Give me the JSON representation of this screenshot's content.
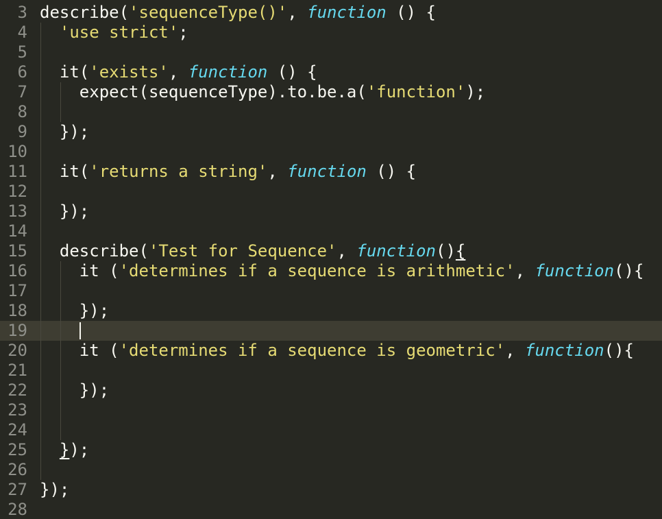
{
  "editor": {
    "colors": {
      "background": "#272822",
      "foreground": "#f8f8f2",
      "string": "#e6db74",
      "keyword_function": "#66d9ef",
      "gutter": "#8f908a",
      "current_line": "#3e3d32",
      "indent_guide": "#49483e"
    },
    "current_line": 19,
    "lines": [
      {
        "n": "3",
        "indent": 0,
        "tokens": [
          {
            "t": "txt",
            "v": "describe("
          },
          {
            "t": "str",
            "v": "'sequenceType()'"
          },
          {
            "t": "txt",
            "v": ", "
          },
          {
            "t": "fn",
            "v": "function"
          },
          {
            "t": "txt",
            "v": " () {"
          }
        ]
      },
      {
        "n": "4",
        "indent": 1,
        "tokens": [
          {
            "t": "str",
            "v": "'use strict'"
          },
          {
            "t": "txt",
            "v": ";"
          }
        ]
      },
      {
        "n": "5",
        "indent": 0,
        "tokens": []
      },
      {
        "n": "6",
        "indent": 1,
        "tokens": [
          {
            "t": "txt",
            "v": "it("
          },
          {
            "t": "str",
            "v": "'exists'"
          },
          {
            "t": "txt",
            "v": ", "
          },
          {
            "t": "fn",
            "v": "function"
          },
          {
            "t": "txt",
            "v": " () {"
          }
        ]
      },
      {
        "n": "7",
        "indent": 2,
        "tokens": [
          {
            "t": "txt",
            "v": "expect(sequenceType).to.be.a("
          },
          {
            "t": "str",
            "v": "'function'"
          },
          {
            "t": "txt",
            "v": ");"
          }
        ]
      },
      {
        "n": "8",
        "indent": 0,
        "tokens": []
      },
      {
        "n": "9",
        "indent": 1,
        "tokens": [
          {
            "t": "txt",
            "v": "});"
          }
        ]
      },
      {
        "n": "10",
        "indent": 0,
        "tokens": []
      },
      {
        "n": "11",
        "indent": 1,
        "tokens": [
          {
            "t": "txt",
            "v": "it("
          },
          {
            "t": "str",
            "v": "'returns a string'"
          },
          {
            "t": "txt",
            "v": ", "
          },
          {
            "t": "fn",
            "v": "function"
          },
          {
            "t": "txt",
            "v": " () {"
          }
        ]
      },
      {
        "n": "12",
        "indent": 0,
        "tokens": []
      },
      {
        "n": "13",
        "indent": 1,
        "tokens": [
          {
            "t": "txt",
            "v": "});"
          }
        ]
      },
      {
        "n": "14",
        "indent": 0,
        "tokens": []
      },
      {
        "n": "15",
        "indent": 1,
        "tokens": [
          {
            "t": "txt",
            "v": "describe("
          },
          {
            "t": "str",
            "v": "'Test for Sequence'"
          },
          {
            "t": "txt",
            "v": ", "
          },
          {
            "t": "fn",
            "v": "function"
          },
          {
            "t": "txt",
            "v": "()"
          },
          {
            "t": "ul",
            "v": "{"
          }
        ]
      },
      {
        "n": "16",
        "indent": 2,
        "tokens": [
          {
            "t": "txt",
            "v": "it ("
          },
          {
            "t": "str",
            "v": "'determines if a sequence is arithmetic'"
          },
          {
            "t": "txt",
            "v": ", "
          },
          {
            "t": "fn",
            "v": "function"
          },
          {
            "t": "txt",
            "v": "(){"
          }
        ]
      },
      {
        "n": "17",
        "indent": 0,
        "tokens": []
      },
      {
        "n": "18",
        "indent": 2,
        "tokens": [
          {
            "t": "txt",
            "v": "});"
          }
        ]
      },
      {
        "n": "19",
        "indent": 0,
        "tokens": []
      },
      {
        "n": "20",
        "indent": 2,
        "tokens": [
          {
            "t": "txt",
            "v": "it ("
          },
          {
            "t": "str",
            "v": "'determines if a sequence is geometric'"
          },
          {
            "t": "txt",
            "v": ", "
          },
          {
            "t": "fn",
            "v": "function"
          },
          {
            "t": "txt",
            "v": "(){"
          }
        ]
      },
      {
        "n": "21",
        "indent": 0,
        "tokens": []
      },
      {
        "n": "22",
        "indent": 2,
        "tokens": [
          {
            "t": "txt",
            "v": "});"
          }
        ]
      },
      {
        "n": "23",
        "indent": 0,
        "tokens": []
      },
      {
        "n": "24",
        "indent": 0,
        "tokens": []
      },
      {
        "n": "25",
        "indent": 1,
        "tokens": [
          {
            "t": "ul",
            "v": "}"
          },
          {
            "t": "txt",
            "v": ");"
          }
        ]
      },
      {
        "n": "26",
        "indent": 0,
        "tokens": []
      },
      {
        "n": "27",
        "indent": 0,
        "tokens": [
          {
            "t": "txt",
            "v": "});"
          }
        ]
      },
      {
        "n": "28",
        "indent": 0,
        "tokens": []
      }
    ]
  }
}
